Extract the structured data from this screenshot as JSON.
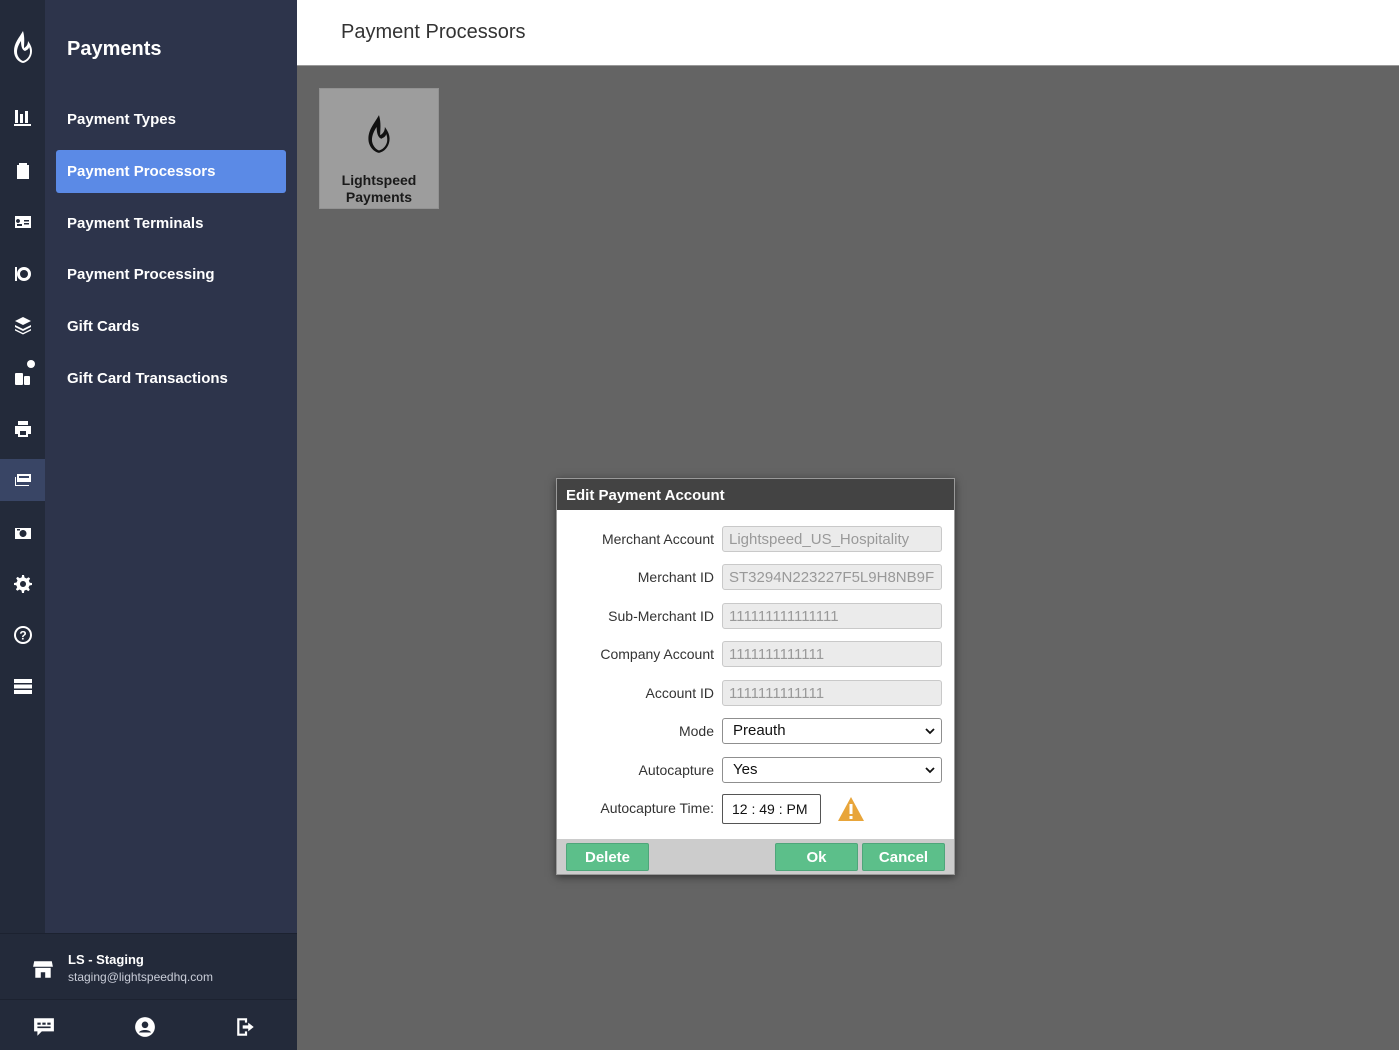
{
  "app": {
    "brand_color": "#5b8ae6"
  },
  "sidebar": {
    "title": "Payments",
    "items": [
      {
        "label": "Payment Types",
        "active": false
      },
      {
        "label": "Payment Processors",
        "active": true
      },
      {
        "label": "Payment Terminals",
        "active": false
      },
      {
        "label": "Payment Processing",
        "active": false
      },
      {
        "label": "Gift Cards",
        "active": false
      },
      {
        "label": "Gift Card Transactions",
        "active": false
      }
    ],
    "account": {
      "name": "LS - Staging",
      "email": "staging@lightspeedhq.com"
    }
  },
  "rail": {
    "icons": [
      "reports-icon",
      "clipboard-icon",
      "id-card-icon",
      "dining-icon",
      "layers-icon",
      "devices-icon",
      "printer-icon",
      "payments-icon",
      "cash-register-icon",
      "gear-icon",
      "help-icon",
      "server-icon"
    ],
    "active": "payments-icon"
  },
  "header": {
    "title": "Payment Processors"
  },
  "processors": [
    {
      "label_line1": "Lightspeed",
      "label_line2": "Payments"
    }
  ],
  "dialog": {
    "title": "Edit Payment Account",
    "fields": {
      "merchant_account": {
        "label": "Merchant Account",
        "value": "Lightspeed_US_Hospitality"
      },
      "merchant_id": {
        "label": "Merchant ID",
        "value": "ST3294N223227F5L9H8NB9F"
      },
      "sub_merchant_id": {
        "label": "Sub-Merchant ID",
        "value": "111111111111111"
      },
      "company_account": {
        "label": "Company Account",
        "value": "1111111111111"
      },
      "account_id": {
        "label": "Account ID",
        "value": "1111111111111"
      },
      "mode": {
        "label": "Mode",
        "value": "Preauth"
      },
      "autocapture": {
        "label": "Autocapture",
        "value": "Yes"
      },
      "autocapture_time": {
        "label": "Autocapture Time:",
        "value": "12 : 49 : PM"
      }
    },
    "buttons": {
      "delete": "Delete",
      "ok": "Ok",
      "cancel": "Cancel"
    }
  }
}
